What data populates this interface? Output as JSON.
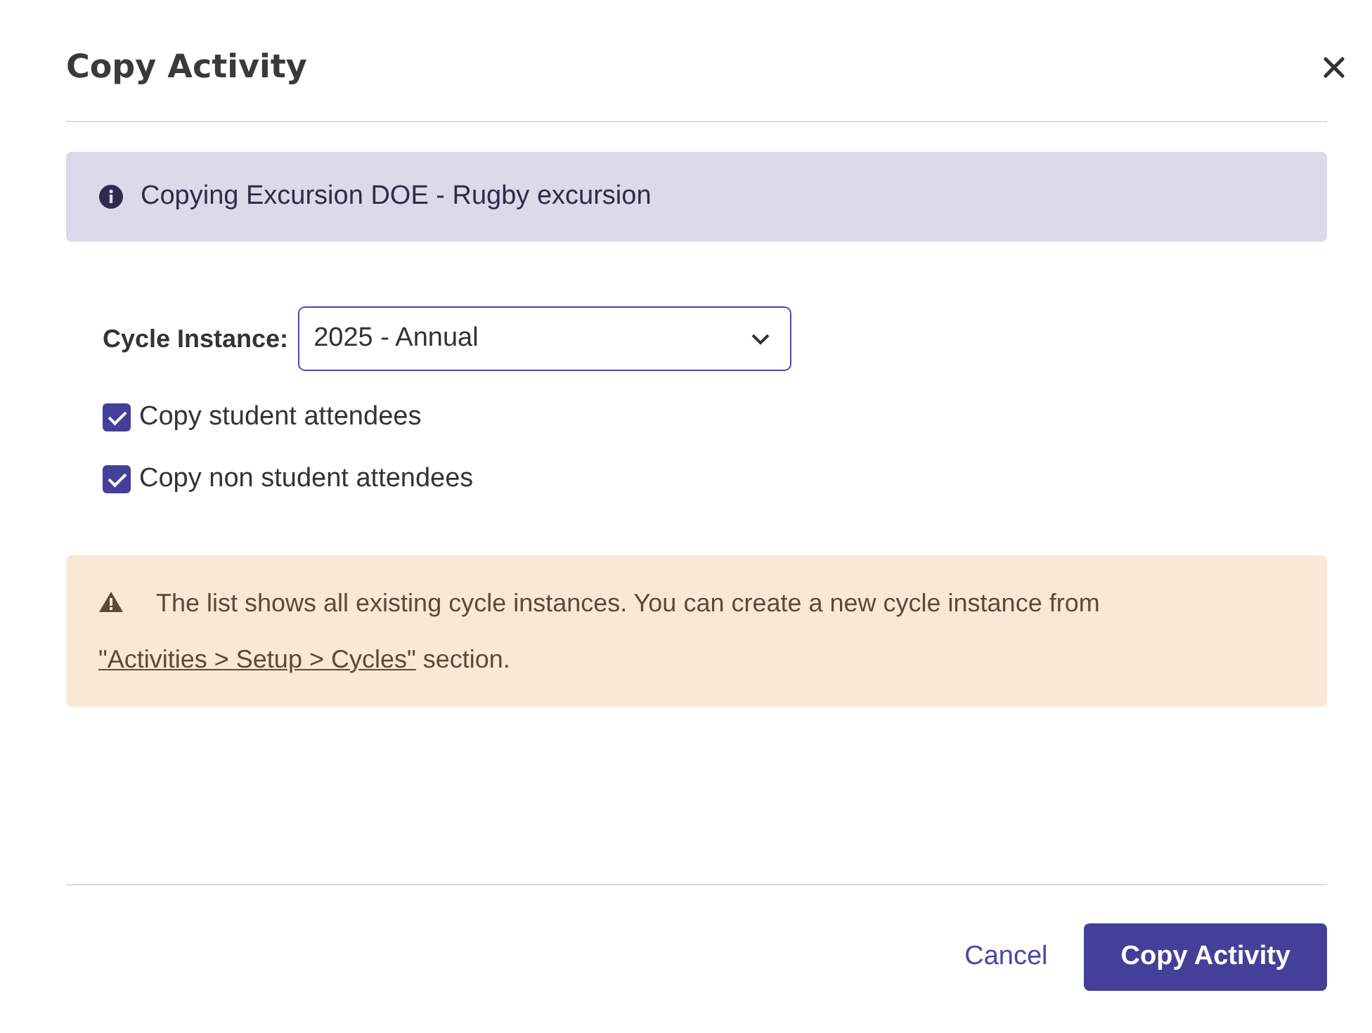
{
  "dialog": {
    "title": "Copy Activity"
  },
  "info": {
    "text": "Copying Excursion DOE - Rugby excursion"
  },
  "cycle_instance": {
    "label": "Cycle Instance:",
    "value": "2025 - Annual"
  },
  "options": [
    {
      "label": "Copy student attendees",
      "checked": true
    },
    {
      "label": "Copy non student attendees",
      "checked": true
    }
  ],
  "warning": {
    "text_before": "The list shows all existing cycle instances. You can create a new cycle instance from ",
    "link": "\"Activities > Setup > Cycles\"",
    "text_after": " section."
  },
  "buttons": [
    {
      "label": "Cancel",
      "kind": "link"
    },
    {
      "label": "Copy Activity",
      "kind": "primary"
    }
  ]
}
